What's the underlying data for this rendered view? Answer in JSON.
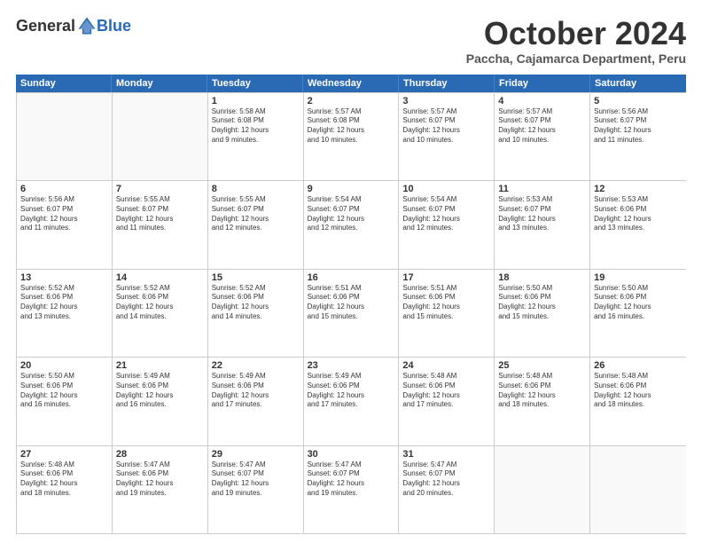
{
  "logo": {
    "general": "General",
    "blue": "Blue"
  },
  "header": {
    "month": "October 2024",
    "location": "Paccha, Cajamarca Department, Peru"
  },
  "weekdays": [
    "Sunday",
    "Monday",
    "Tuesday",
    "Wednesday",
    "Thursday",
    "Friday",
    "Saturday"
  ],
  "weeks": [
    [
      {
        "day": "",
        "info": ""
      },
      {
        "day": "",
        "info": ""
      },
      {
        "day": "1",
        "info": "Sunrise: 5:58 AM\nSunset: 6:08 PM\nDaylight: 12 hours\nand 9 minutes."
      },
      {
        "day": "2",
        "info": "Sunrise: 5:57 AM\nSunset: 6:08 PM\nDaylight: 12 hours\nand 10 minutes."
      },
      {
        "day": "3",
        "info": "Sunrise: 5:57 AM\nSunset: 6:07 PM\nDaylight: 12 hours\nand 10 minutes."
      },
      {
        "day": "4",
        "info": "Sunrise: 5:57 AM\nSunset: 6:07 PM\nDaylight: 12 hours\nand 10 minutes."
      },
      {
        "day": "5",
        "info": "Sunrise: 5:56 AM\nSunset: 6:07 PM\nDaylight: 12 hours\nand 11 minutes."
      }
    ],
    [
      {
        "day": "6",
        "info": "Sunrise: 5:56 AM\nSunset: 6:07 PM\nDaylight: 12 hours\nand 11 minutes."
      },
      {
        "day": "7",
        "info": "Sunrise: 5:55 AM\nSunset: 6:07 PM\nDaylight: 12 hours\nand 11 minutes."
      },
      {
        "day": "8",
        "info": "Sunrise: 5:55 AM\nSunset: 6:07 PM\nDaylight: 12 hours\nand 12 minutes."
      },
      {
        "day": "9",
        "info": "Sunrise: 5:54 AM\nSunset: 6:07 PM\nDaylight: 12 hours\nand 12 minutes."
      },
      {
        "day": "10",
        "info": "Sunrise: 5:54 AM\nSunset: 6:07 PM\nDaylight: 12 hours\nand 12 minutes."
      },
      {
        "day": "11",
        "info": "Sunrise: 5:53 AM\nSunset: 6:07 PM\nDaylight: 12 hours\nand 13 minutes."
      },
      {
        "day": "12",
        "info": "Sunrise: 5:53 AM\nSunset: 6:06 PM\nDaylight: 12 hours\nand 13 minutes."
      }
    ],
    [
      {
        "day": "13",
        "info": "Sunrise: 5:52 AM\nSunset: 6:06 PM\nDaylight: 12 hours\nand 13 minutes."
      },
      {
        "day": "14",
        "info": "Sunrise: 5:52 AM\nSunset: 6:06 PM\nDaylight: 12 hours\nand 14 minutes."
      },
      {
        "day": "15",
        "info": "Sunrise: 5:52 AM\nSunset: 6:06 PM\nDaylight: 12 hours\nand 14 minutes."
      },
      {
        "day": "16",
        "info": "Sunrise: 5:51 AM\nSunset: 6:06 PM\nDaylight: 12 hours\nand 15 minutes."
      },
      {
        "day": "17",
        "info": "Sunrise: 5:51 AM\nSunset: 6:06 PM\nDaylight: 12 hours\nand 15 minutes."
      },
      {
        "day": "18",
        "info": "Sunrise: 5:50 AM\nSunset: 6:06 PM\nDaylight: 12 hours\nand 15 minutes."
      },
      {
        "day": "19",
        "info": "Sunrise: 5:50 AM\nSunset: 6:06 PM\nDaylight: 12 hours\nand 16 minutes."
      }
    ],
    [
      {
        "day": "20",
        "info": "Sunrise: 5:50 AM\nSunset: 6:06 PM\nDaylight: 12 hours\nand 16 minutes."
      },
      {
        "day": "21",
        "info": "Sunrise: 5:49 AM\nSunset: 6:06 PM\nDaylight: 12 hours\nand 16 minutes."
      },
      {
        "day": "22",
        "info": "Sunrise: 5:49 AM\nSunset: 6:06 PM\nDaylight: 12 hours\nand 17 minutes."
      },
      {
        "day": "23",
        "info": "Sunrise: 5:49 AM\nSunset: 6:06 PM\nDaylight: 12 hours\nand 17 minutes."
      },
      {
        "day": "24",
        "info": "Sunrise: 5:48 AM\nSunset: 6:06 PM\nDaylight: 12 hours\nand 17 minutes."
      },
      {
        "day": "25",
        "info": "Sunrise: 5:48 AM\nSunset: 6:06 PM\nDaylight: 12 hours\nand 18 minutes."
      },
      {
        "day": "26",
        "info": "Sunrise: 5:48 AM\nSunset: 6:06 PM\nDaylight: 12 hours\nand 18 minutes."
      }
    ],
    [
      {
        "day": "27",
        "info": "Sunrise: 5:48 AM\nSunset: 6:06 PM\nDaylight: 12 hours\nand 18 minutes."
      },
      {
        "day": "28",
        "info": "Sunrise: 5:47 AM\nSunset: 6:06 PM\nDaylight: 12 hours\nand 19 minutes."
      },
      {
        "day": "29",
        "info": "Sunrise: 5:47 AM\nSunset: 6:07 PM\nDaylight: 12 hours\nand 19 minutes."
      },
      {
        "day": "30",
        "info": "Sunrise: 5:47 AM\nSunset: 6:07 PM\nDaylight: 12 hours\nand 19 minutes."
      },
      {
        "day": "31",
        "info": "Sunrise: 5:47 AM\nSunset: 6:07 PM\nDaylight: 12 hours\nand 20 minutes."
      },
      {
        "day": "",
        "info": ""
      },
      {
        "day": "",
        "info": ""
      }
    ]
  ]
}
